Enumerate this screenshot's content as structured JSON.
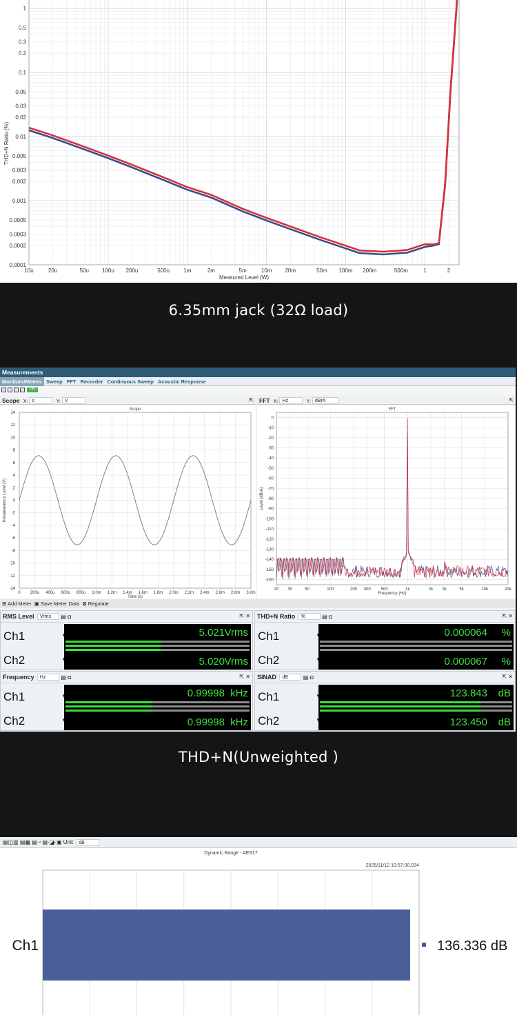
{
  "top_chart": {
    "ylabel": "THD+N Ratio (%)",
    "xlabel": "Measured Level (W)",
    "y_ticks": [
      "1",
      "0.5",
      "0.3",
      "0.2",
      "0.1",
      "0.05",
      "0.03",
      "0.02",
      "0.01",
      "0.005",
      "0.003",
      "0.002",
      "0.001",
      "0.0005",
      "0.0003",
      "0.0002",
      "0.0001"
    ],
    "x_ticks": [
      "10u",
      "20u",
      "50u",
      "100u",
      "200u",
      "500u",
      "1m",
      "2m",
      "5m",
      "10m",
      "20m",
      "50m",
      "100m",
      "200m",
      "500m",
      "1",
      "2"
    ]
  },
  "caption_1": "6.35mm jack (32Ω load)",
  "app": {
    "title": "Measurements",
    "tabs": [
      "Monitors/Meters",
      "Sweep",
      "FFT",
      "Recorder",
      "Continuous Sweep",
      "Acoustic Response"
    ],
    "on_label": "ON"
  },
  "scope": {
    "name": "Scope",
    "x_label": "X:",
    "x_unit": "s",
    "y_label": "Y:",
    "y_unit": "V",
    "plot_title": "Scope",
    "ylabel": "Instantaneous Level (V)",
    "xlabel": "Time (s)",
    "y_ticks": [
      "14",
      "12",
      "10",
      "8",
      "6",
      "4",
      "2",
      "0",
      "-2",
      "-4",
      "-6",
      "-8",
      "-10",
      "-12",
      "-14"
    ],
    "x_ticks": [
      "0",
      "200u",
      "400u",
      "600u",
      "800u",
      "1.0m",
      "1.2m",
      "1.4m",
      "1.6m",
      "1.8m",
      "2.0m",
      "2.2m",
      "2.4m",
      "2.6m",
      "2.8m",
      "3.0m"
    ]
  },
  "fft": {
    "name": "FFT",
    "x_label": "X:",
    "x_unit": "Hz",
    "y_label": "Y:",
    "y_unit": "dBrA",
    "plot_title": "FFT",
    "ylabel": "Level (dBrA)",
    "xlabel": "Frequency (Hz)",
    "y_ticks": [
      "0",
      "-10",
      "-20",
      "-30",
      "-40",
      "-50",
      "-60",
      "-70",
      "-80",
      "-90",
      "-100",
      "-110",
      "-120",
      "-130",
      "-140",
      "-150",
      "-160"
    ],
    "x_ticks": [
      "20",
      "30",
      "50",
      "100",
      "200",
      "300",
      "500",
      "1k",
      "2k",
      "3k",
      "5k",
      "10k",
      "20k"
    ]
  },
  "meter_bar": {
    "add": "Add Meter",
    "save": "Save Meter Data",
    "regulate": "Regulate"
  },
  "meters": [
    {
      "name": "RMS Level",
      "unit_sel": "Vrms",
      "ch1": {
        "label": "Ch1",
        "value": "5.021",
        "unit": "Vrms"
      },
      "ch2": {
        "label": "Ch2",
        "value": "5.020",
        "unit": "Vrms"
      },
      "fill": 0.63
    },
    {
      "name": "THD+N Ratio",
      "unit_sel": "%",
      "ch1": {
        "label": "Ch1",
        "value": "0.000064",
        "unit": "%"
      },
      "ch2": {
        "label": "Ch2",
        "value": "0.000067",
        "unit": "%"
      },
      "fill": 0.0
    },
    {
      "name": "Frequency",
      "unit_sel": "Hz",
      "ch1": {
        "label": "Ch1",
        "value": "0.99998",
        "unit": "kHz"
      },
      "ch2": {
        "label": "Ch2",
        "value": "0.99998",
        "unit": "kHz"
      },
      "fill": 0.57
    },
    {
      "name": "SINAD",
      "unit_sel": "dB",
      "ch1": {
        "label": "Ch1",
        "value": "123.843",
        "unit": "dB"
      },
      "ch2": {
        "label": "Ch2",
        "value": "123.450",
        "unit": "dB"
      },
      "fill": 1.0
    }
  ],
  "caption_2": "THD+N(Unweighted )",
  "dr": {
    "unit_label": "Unit",
    "unit_value": "dB",
    "title": "Dynamic Range - AES17",
    "timestamp": "2025/11/12 10:57:00.934",
    "channel": "Ch1",
    "value_text": "136.336 dB"
  },
  "colors": {
    "red": "#d8323b",
    "blue": "#3f4f8e",
    "green": "#3fdd3f",
    "bar": "#4a5f9a"
  }
}
